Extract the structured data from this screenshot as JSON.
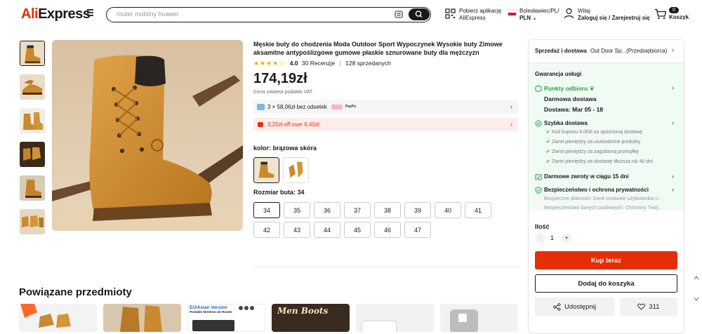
{
  "header": {
    "logo_part1": "Ali",
    "logo_part2": "Express",
    "search_placeholder": "router mobilny huawei",
    "app_line1": "Pobierz aplikację",
    "app_line2": "AliExpress",
    "region_line1": "Bolesławiec/PL/",
    "region_line2": "PLN",
    "account_line1": "Witaj",
    "account_line2": "Zaloguj się / Zarejestruj się",
    "cart_count": "0",
    "cart_label": "Koszyk"
  },
  "product": {
    "title": "Męskie buty do chodzenia Moda Outdoor Sport Wypoczynek Wysokie buty Zimowe aksamitne antypoślizgowe gumowe płaskie sznurowane buty dla mężczyzn",
    "rating": "4.0",
    "stars": 4,
    "reviews": "30 Recenzje",
    "sold": "128 sprzedanych",
    "price": "174,19zł",
    "vat_note": "Cena zawiera podatek VAT",
    "installments": "3 × 58,06zł bez odsetek",
    "coupon": "3,20zł off over 6,40zł",
    "color_label": "kolor: brązowa skóra",
    "size_label": "Rozmiar buta: 34",
    "sizes_row1": [
      "34",
      "35",
      "36",
      "37",
      "38",
      "39",
      "40",
      "41"
    ],
    "sizes_row2": [
      "42",
      "43",
      "44",
      "45",
      "46",
      "47"
    ],
    "selected_size": "34"
  },
  "related": {
    "title": "Powiązane przedmioty",
    "card3_line1": "EU/Asian Version",
    "card3_line2": "Portable Wireless 4G Router",
    "card4_text": "Men Boots"
  },
  "panel": {
    "shipping_label": "Sprzedaż i dostawa",
    "store_name": "Out Door Sp...(Przedsiębiorca)",
    "guarantee": "Gwarancja usługi",
    "pickup": "Punkty odbioru",
    "free_delivery": "Darmowa dostawa",
    "delivery_date": "Dostawa: Mar 05 - 18",
    "fast_delivery": "Szybka dostawa",
    "fast_items": [
      "Kod kuponu 4,00zł za spóźnioną dostawę",
      "Zwrot pieniędzy za uszkodzone produkty",
      "Zwrot pieniędzy za zagubioną przesyłkę",
      "Zwrot pieniędzy za dostawę dłuższą niż 40 dni"
    ],
    "free_returns": "Darmowe zwroty w ciągu 15 dni",
    "security": "Bezpieczeństwo i ochrona prywatności",
    "security_line1": "Bezpieczne płatności: Dane osobowe użytkownika n...",
    "security_line2": "Bezpieczeństwo danych osobowych: Chronimy Twoj...",
    "qty_label": "Ilość",
    "qty_value": "1",
    "minus": "-",
    "plus": "+",
    "buy_now": "Kup teraz",
    "add_to_cart": "Dodaj do koszyka",
    "share": "Udostępnij",
    "likes": "311"
  },
  "colors": {
    "brand_red": "#e62e04",
    "green": "#23a04b",
    "star": "#f7a500"
  }
}
